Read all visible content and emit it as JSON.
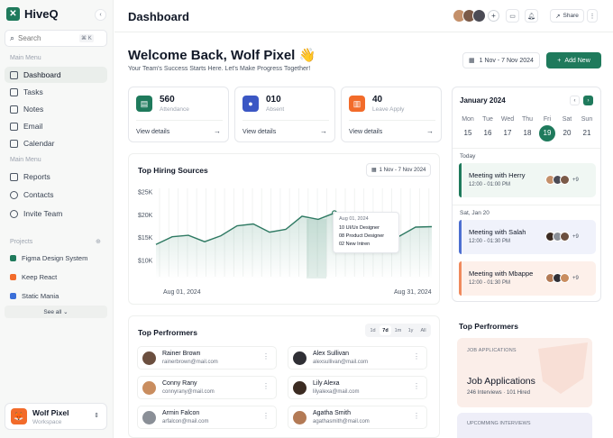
{
  "app": {
    "name": "HiveQ"
  },
  "sidebar": {
    "search_placeholder": "Search",
    "search_shortcut": "⌘ K",
    "section_main": "Main Menu",
    "items_top": [
      {
        "label": "Dashboard",
        "icon": "grid-icon",
        "active": true
      },
      {
        "label": "Tasks",
        "icon": "checkbox-icon"
      },
      {
        "label": "Notes",
        "icon": "note-icon"
      },
      {
        "label": "Email",
        "icon": "mail-icon"
      },
      {
        "label": "Calendar",
        "icon": "calendar-icon"
      }
    ],
    "section_main_2": "Main Menu",
    "items_bottom": [
      {
        "label": "Reports",
        "icon": "file-icon"
      },
      {
        "label": "Contacts",
        "icon": "user-icon"
      },
      {
        "label": "Invite Team",
        "icon": "user-plus-icon"
      }
    ],
    "section_projects": "Projects",
    "projects": [
      {
        "label": "Figma Design System",
        "color": "#1f7a5c"
      },
      {
        "label": "Keep React",
        "color": "#f26b2a"
      },
      {
        "label": "Static Mania",
        "color": "#3b6fd8"
      }
    ],
    "see_all": "See all",
    "workspace": {
      "name": "Wolf Pixel",
      "sub": "Workspace"
    }
  },
  "header": {
    "title": "Dashboard",
    "share": "Share"
  },
  "welcome": {
    "title": "Welcome Back, Wolf Pixel 👋",
    "subtitle": "Your Team's Success Starts Here. Let's Make Progress Together!",
    "date_range": "1 Nov - 7 Nov 2024",
    "add_button": "Add New"
  },
  "stats": [
    {
      "value": "560",
      "label": "Attendance",
      "link": "View details",
      "color": "#1f7a5c"
    },
    {
      "value": "010",
      "label": "Absent",
      "link": "View details",
      "color": "#3b57c4"
    },
    {
      "value": "40",
      "label": "Leave Apply",
      "link": "View details",
      "color": "#f26b2a"
    }
  ],
  "hiring": {
    "title": "Top Hiring Sources",
    "date_range": "1 Nov - 7 Nov 2024",
    "tooltip": {
      "date": "Aug 01, 2024",
      "lines": [
        "10 UI/Ux Designer",
        "08 Product Designer",
        "02 New Intren"
      ]
    }
  },
  "chart_data": {
    "type": "area",
    "title": "Top Hiring Sources",
    "x_labels": [
      "Aug 01, 2024",
      "Aug 31, 2024"
    ],
    "y_ticks": [
      "$10K",
      "$15K",
      "$20K",
      "$25K"
    ],
    "ylim": [
      10,
      25
    ],
    "values": [
      13.5,
      15.2,
      15.5,
      14.1,
      15.4,
      17.6,
      18.0,
      16.2,
      16.8,
      19.7,
      19.0,
      20.4,
      18.5,
      15.4,
      16.4,
      15.3,
      17.3,
      17.4
    ]
  },
  "calendar": {
    "month": "January 2024",
    "weekdays": [
      "Mon",
      "Tue",
      "Wed",
      "Thu",
      "Fri",
      "Sat",
      "Sun"
    ],
    "days": [
      "15",
      "16",
      "17",
      "18",
      "19",
      "20",
      "21"
    ],
    "selected": "19",
    "today_label": "Today",
    "next_label": "Sat, Jan 20",
    "meetings": [
      {
        "title": "Meeting with Herry",
        "time": "12:00 - 01:00 PM",
        "more": "+9",
        "bg": "#f0f7f3",
        "bar": "#1f7a5c"
      },
      {
        "title": "Meeting with Salah",
        "time": "12:00 - 01:30 PM",
        "more": "+9",
        "bg": "#f0f2fb",
        "bar": "#4d6fd1"
      },
      {
        "title": "Meeting with Mbappe",
        "time": "12:00 - 01:30 PM",
        "more": "+9",
        "bg": "#fdf0ea",
        "bar": "#f08a5d"
      }
    ]
  },
  "performers": {
    "title": "Top Perfrormers",
    "filters": [
      "1d",
      "7d",
      "1m",
      "1y",
      "All"
    ],
    "active_filter": "7d",
    "people": [
      {
        "name": "Rainer Brown",
        "email": "rainerbrown@mail.com",
        "avatar": "#6b4f3f"
      },
      {
        "name": "Alex Sullivan",
        "email": "alexsullivan@mail.com",
        "avatar": "#2f2f35"
      },
      {
        "name": "Conny Rany",
        "email": "connyrany@mail.com",
        "avatar": "#c98d5f"
      },
      {
        "name": "Lily Alexa",
        "email": "lilyalexa@mail.com",
        "avatar": "#3b2b22"
      },
      {
        "name": "Armin Falcon",
        "email": "arfalcon@mail.com",
        "avatar": "#8a8f97"
      },
      {
        "name": "Agatha Smith",
        "email": "agathasmith@mail.com",
        "avatar": "#b37a55"
      }
    ]
  },
  "right_performers": {
    "title": "Top Perfrormers",
    "job_tag": "JOB APPLICATIONS",
    "job_title": "Job Applications",
    "job_interviews": "246 Interviews",
    "job_hired": "101 Hired",
    "upcoming_tag": "UPCOMMING INTERVIEWS"
  }
}
